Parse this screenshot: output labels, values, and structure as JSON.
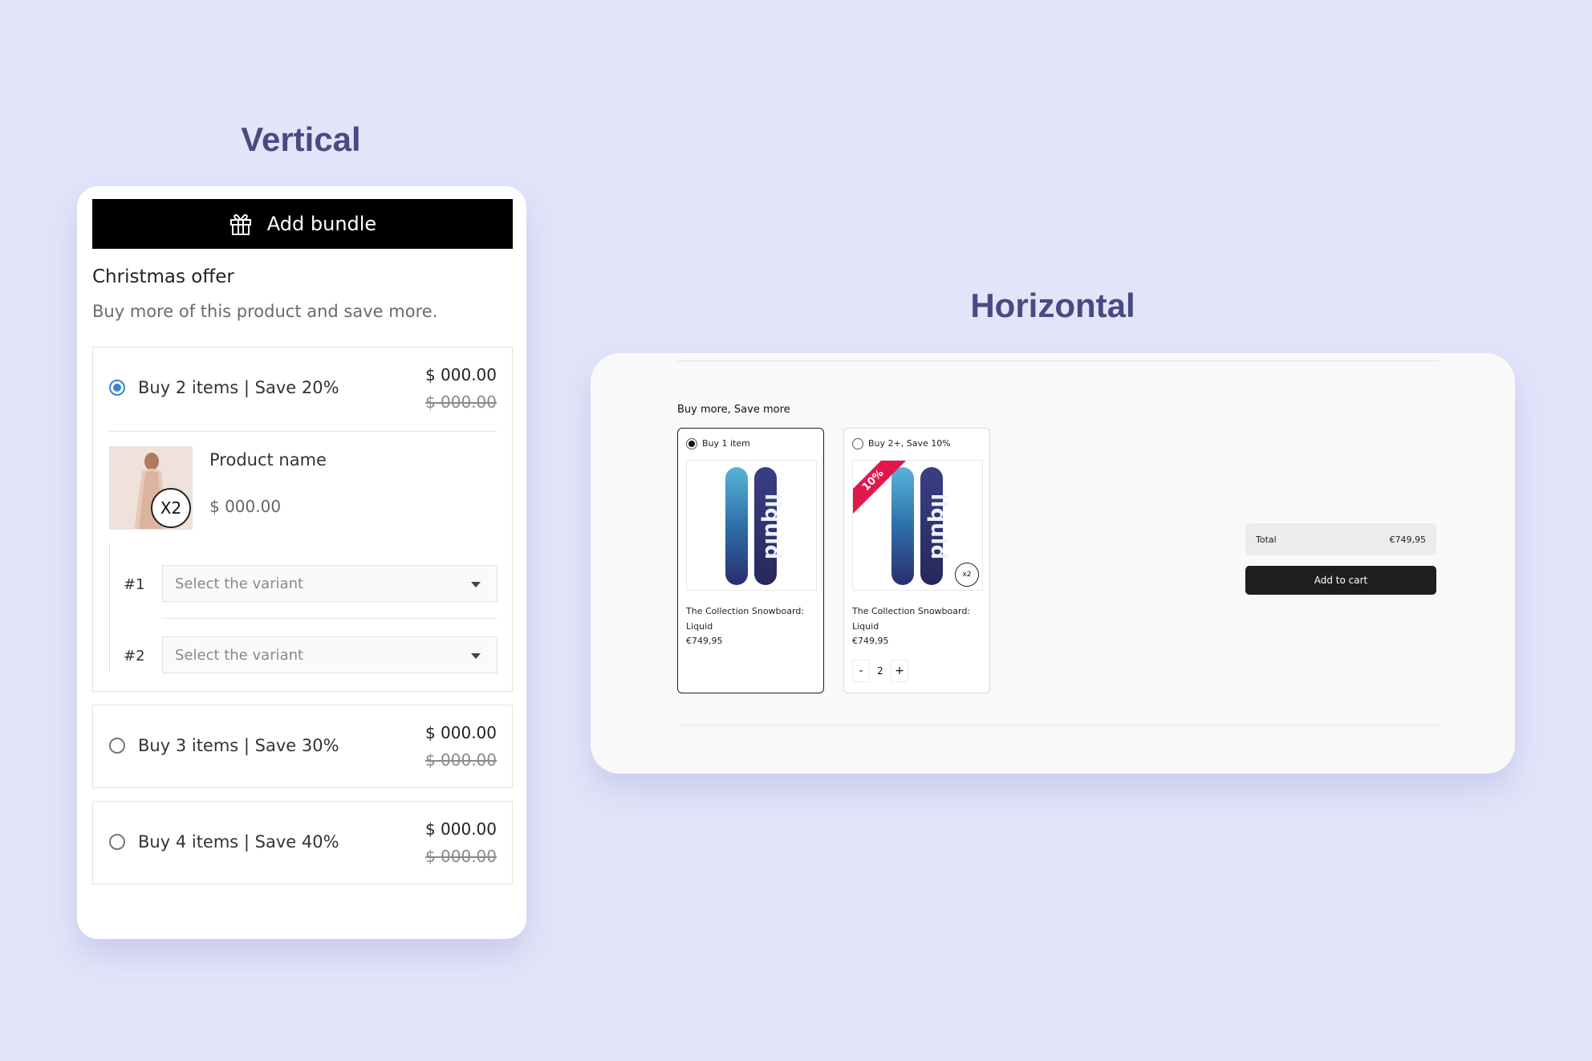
{
  "headings": {
    "vertical": "Vertical",
    "horizontal": "Horizontal"
  },
  "vertical": {
    "add_bundle_label": "Add bundle",
    "offer_title": "Christmas offer",
    "offer_subtitle": "Buy more of this product and save more.",
    "tiers": [
      {
        "label": "Buy 2 items | Save 20%",
        "price": "$ 000.00",
        "compare_price": "$ 000.00",
        "selected": true
      },
      {
        "label": "Buy 3 items | Save 30%",
        "price": "$ 000.00",
        "compare_price": "$ 000.00",
        "selected": false
      },
      {
        "label": "Buy 4 items | Save 40%",
        "price": "$ 000.00",
        "compare_price": "$ 000.00",
        "selected": false
      }
    ],
    "product": {
      "name": "Product name",
      "price": "$ 000.00",
      "quantity_badge": "X2"
    },
    "variants": [
      {
        "number": "#1",
        "placeholder": "Select the variant"
      },
      {
        "number": "#2",
        "placeholder": "Select the variant"
      }
    ]
  },
  "horizontal": {
    "title": "Buy more, Save more",
    "options": [
      {
        "label": "Buy 1 item",
        "product_name": "The Collection Snowboard: Liquid",
        "price": "€749,95",
        "selected": true
      },
      {
        "label": "Buy 2+, Save 10%",
        "product_name": "The Collection Snowboard: Liquid",
        "price": "€749,95",
        "selected": false,
        "ribbon": "10%",
        "quantity_badge": "x2",
        "quantity": "2",
        "minus": "-",
        "plus": "+"
      }
    ],
    "total_label": "Total",
    "total_value": "€749,95",
    "add_to_cart_label": "Add to cart"
  },
  "colors": {
    "background": "#e2e5f9",
    "heading": "#4a4a82",
    "radio_accent": "#3b82d6",
    "ribbon": "#e2174c"
  }
}
